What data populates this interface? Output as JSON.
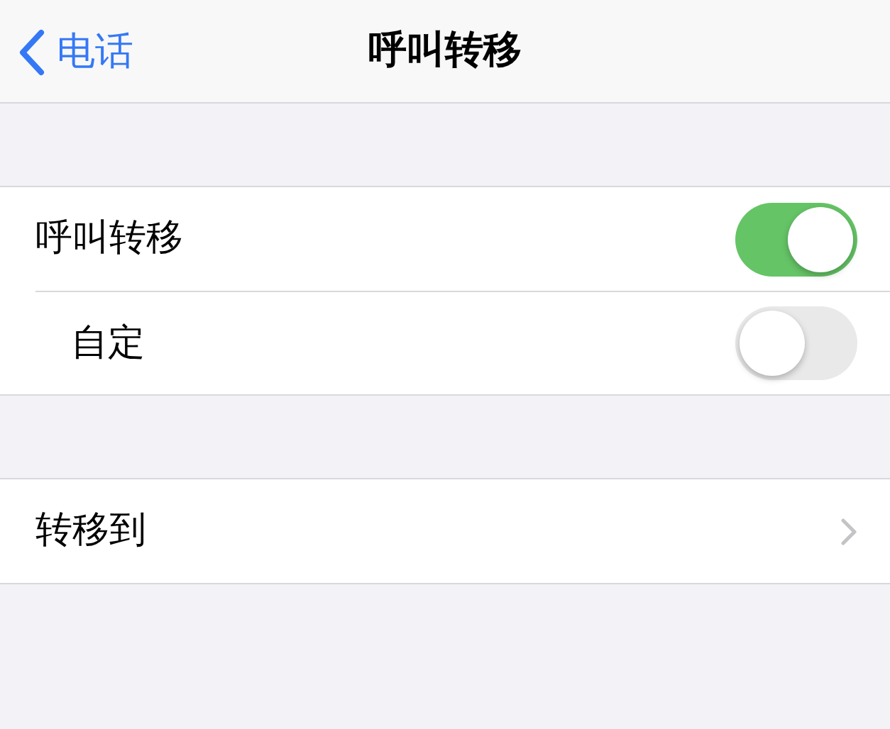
{
  "nav": {
    "back_label": "电话",
    "title": "呼叫转移"
  },
  "sections": [
    {
      "rows": [
        {
          "kind": "toggle",
          "label": "呼叫转移",
          "on": true
        },
        {
          "kind": "toggle",
          "label": "自定",
          "on": false
        }
      ]
    },
    {
      "rows": [
        {
          "kind": "link",
          "label": "转移到"
        }
      ]
    }
  ]
}
